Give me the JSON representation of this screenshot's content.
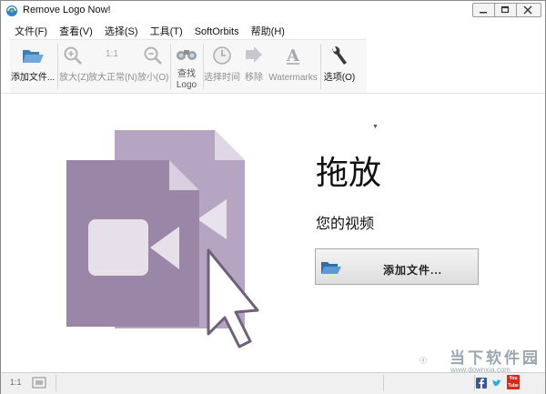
{
  "window": {
    "title": "Remove Logo Now!"
  },
  "menu": {
    "items": [
      "文件(F)",
      "查看(V)",
      "选择(S)",
      "工具(T)",
      "SoftOrbits",
      "帮助(H)"
    ]
  },
  "toolbar": {
    "add_files": "添加文件...",
    "zoom_in": "放大(Z)",
    "zoom_normal_icon_text": "1:1",
    "zoom_normal": "放大正常(N)",
    "zoom_out": "放小(O)",
    "find_logo_line1": "查找",
    "find_logo_line2": "Logo",
    "select_time": "选择时间",
    "remove": "移除",
    "watermarks": "Watermarks",
    "options": "选项(O)"
  },
  "drop_area": {
    "title": "拖放",
    "subtitle": "您的视频",
    "add_file_button": "添加文件..."
  },
  "statusbar": {
    "ratio": "1:1",
    "youtube_text": "You Tube"
  },
  "watermark": {
    "title": "当下软件园",
    "url": "www.downxia.com"
  },
  "colors": {
    "art_primary": "#9a87a8",
    "art_secondary": "#b6a5c2",
    "toolbar_bg": "#f7f7f7",
    "status_bg": "#f0f0f0"
  }
}
